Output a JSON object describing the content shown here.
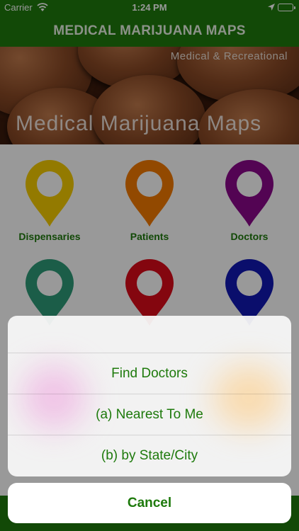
{
  "status_bar": {
    "carrier": "Carrier",
    "time": "1:24 PM"
  },
  "nav": {
    "title": "MEDICAL MARIJUANA MAPS"
  },
  "banner": {
    "subtitle": "Medical & Recreational",
    "title": "Medical Marijuana Maps"
  },
  "categories": [
    {
      "label": "Dispensaries",
      "color": "#f5cc00"
    },
    {
      "label": "Patients",
      "color": "#f47a00"
    },
    {
      "label": "Doctors",
      "color": "#8a088a"
    },
    {
      "label": "",
      "color": "#2e9c78"
    },
    {
      "label": "",
      "color": "#dd0a1a"
    },
    {
      "label": "",
      "color": "#1218b4"
    }
  ],
  "action_sheet": {
    "header": "",
    "options": [
      "Find Doctors",
      "(a) Nearest To Me",
      "(b) by State/City"
    ],
    "cancel": "Cancel"
  },
  "colors": {
    "brand_green": "#1f7a0c",
    "text_green": "#1e7a0c"
  }
}
